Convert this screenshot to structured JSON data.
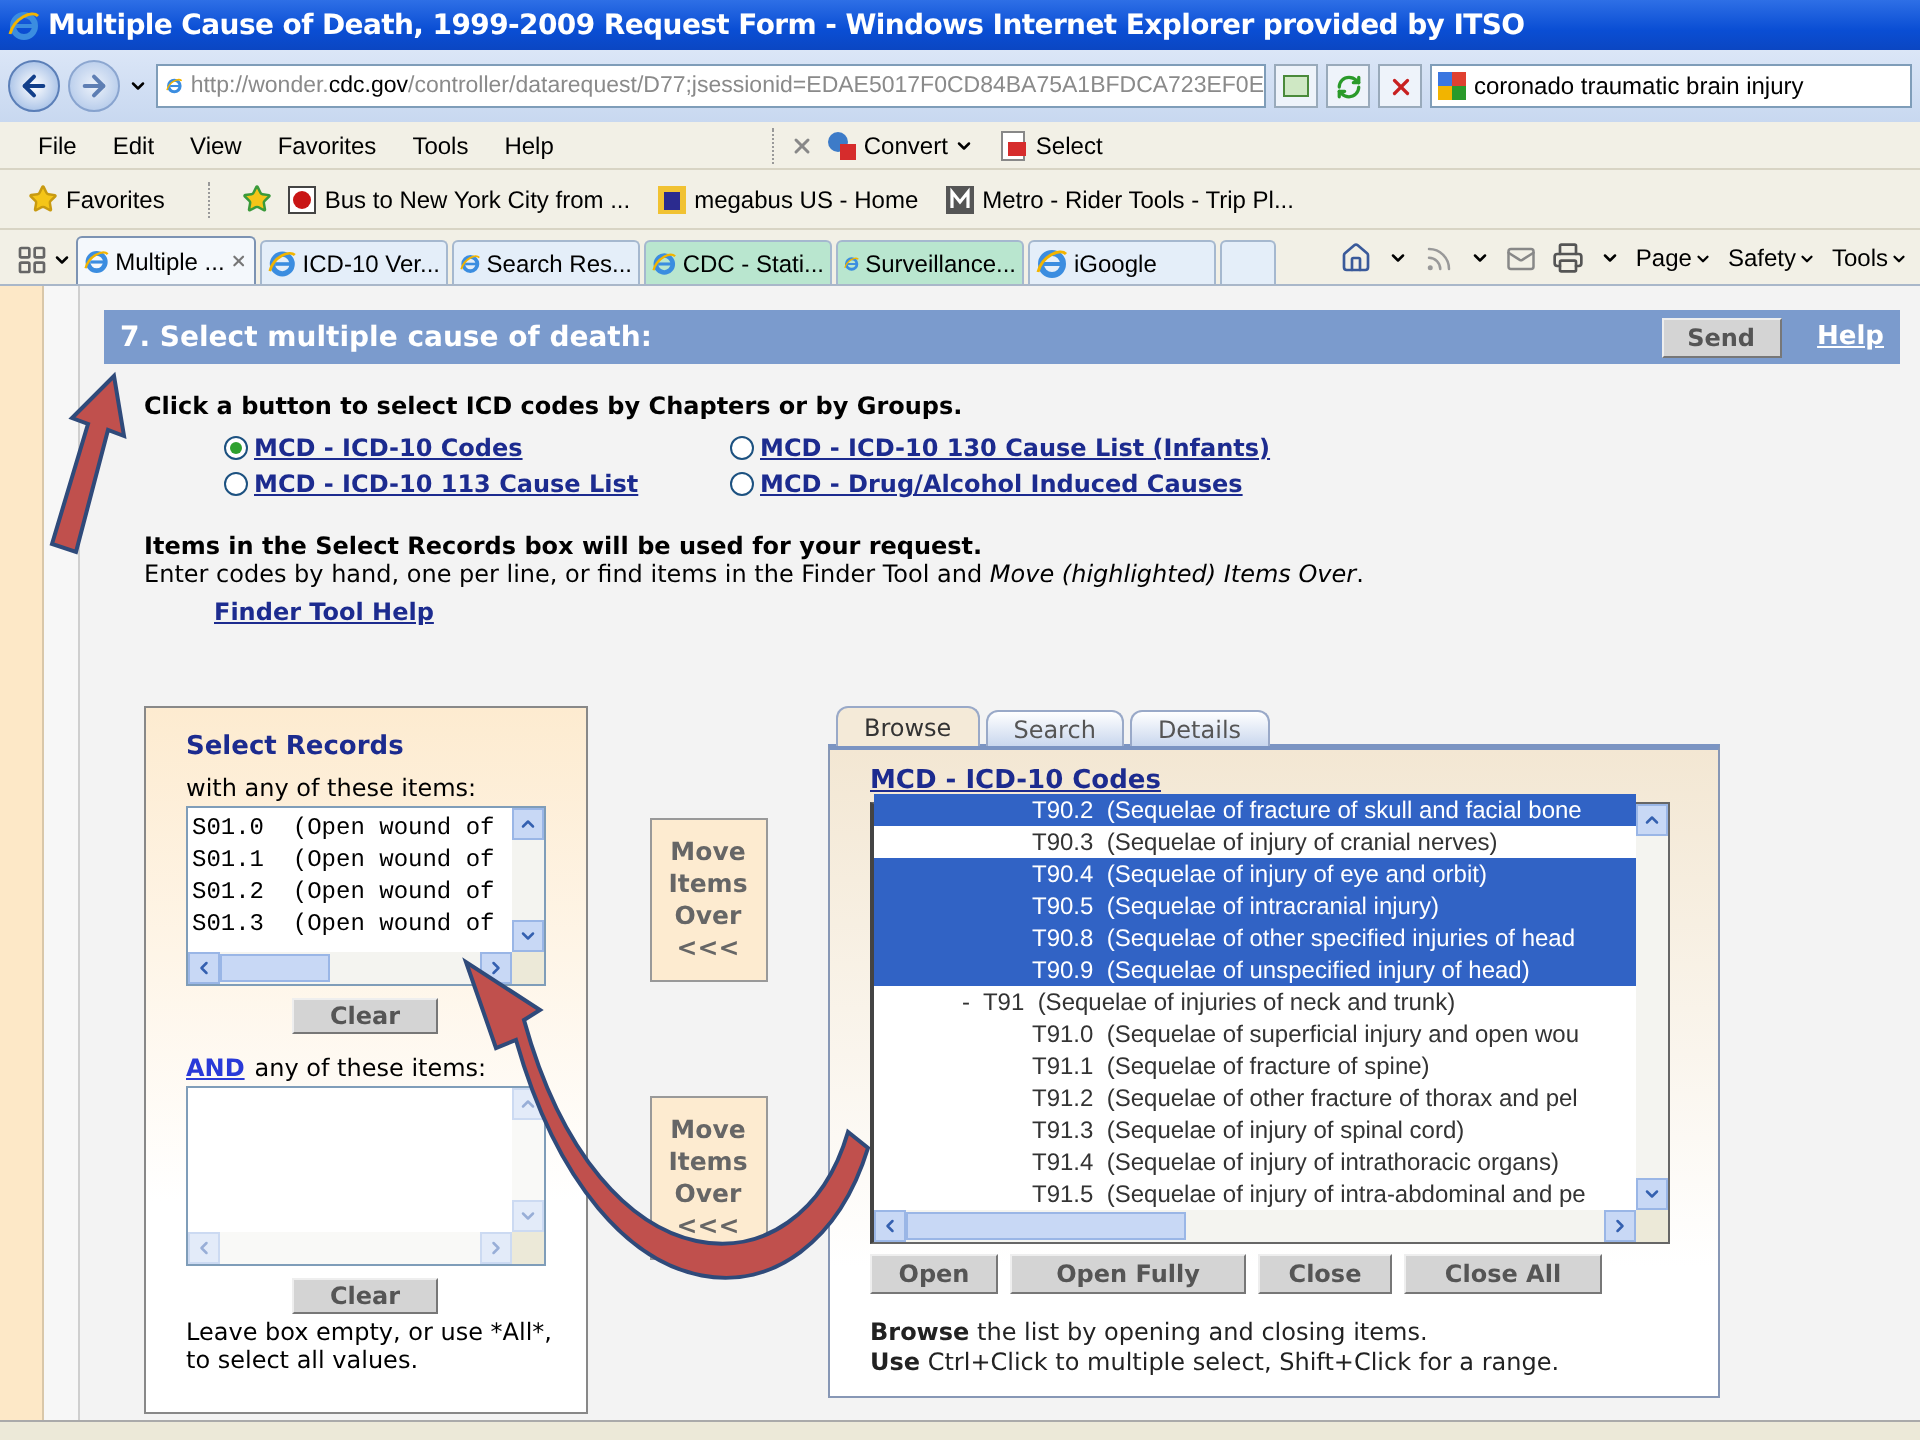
{
  "window": {
    "title": "Multiple Cause of Death, 1999-2009 Request Form - Windows Internet Explorer provided by ITSO"
  },
  "address_bar": {
    "url_start": "http://wonder.",
    "url_host": "cdc.gov",
    "url_end": "/controller/datarequest/D77;jsessionid=EDAE5017F0CD84BA75A1BFDCA723EF0E"
  },
  "search_field": {
    "value": "coronado traumatic brain injury"
  },
  "menu": [
    "File",
    "Edit",
    "View",
    "Favorites",
    "Tools",
    "Help"
  ],
  "toolbar_buttons": [
    {
      "label": "Convert",
      "kind": "convert"
    },
    {
      "label": "Select",
      "kind": "select"
    }
  ],
  "favorites_bar": {
    "label": "Favorites",
    "links": [
      {
        "label": "Bus to New York City from ...",
        "kind": "bus"
      },
      {
        "label": "megabus US - Home",
        "kind": "megabus"
      },
      {
        "label": "Metro - Rider Tools - Trip Pl...",
        "kind": "metro"
      }
    ]
  },
  "tabs": [
    {
      "label": "Multiple ...",
      "selected": true,
      "color": "#f4f8fc"
    },
    {
      "label": "ICD-10 Ver...",
      "selected": false,
      "color": "#e4eef9"
    },
    {
      "label": "Search Res...",
      "selected": false,
      "color": "#e4eef9"
    },
    {
      "label": "CDC - Stati...",
      "selected": false,
      "color": "#b9e6cf"
    },
    {
      "label": "Surveillance...",
      "selected": false,
      "color": "#b9e6cf"
    },
    {
      "label": "iGoogle",
      "selected": false,
      "color": "#e4eef9"
    }
  ],
  "command_bar": [
    "Page",
    "Safety",
    "Tools"
  ],
  "section": {
    "title": "7. Select multiple cause of death:",
    "send": "Send",
    "help": "Help",
    "instruction": "Click a button to select ICD codes by Chapters or by Groups.",
    "options": [
      {
        "label": "MCD - ICD-10 Codes",
        "selected": true
      },
      {
        "label": "MCD - ICD-10 130 Cause List (Infants)",
        "selected": false
      },
      {
        "label": "MCD - ICD-10 113 Cause List",
        "selected": false
      },
      {
        "label": "MCD - Drug/Alcohol Induced Causes",
        "selected": false
      }
    ],
    "items_heading": "Items in the Select Records box will be used for your request.",
    "items_text": "Enter codes by hand, one per line, or find items in the Finder Tool and *Move (highlighted) Items Over*.",
    "finder_help": "Finder Tool Help"
  },
  "select_records": {
    "title": "Select Records",
    "first_label": "with any of these items:",
    "first_items": [
      "S01.0  (Open wound of",
      "S01.1  (Open wound of",
      "S01.2  (Open wound of",
      "S01.3  (Open wound of"
    ],
    "clear": "Clear",
    "and_link": "AND",
    "second_label": "any of these items:",
    "second_clear": "Clear",
    "note": "Leave box empty, or use *All*, to select all values."
  },
  "move_buttons": [
    "Move Items Over <<<",
    "Move Items Over <<<"
  ],
  "finder": {
    "tabs": [
      {
        "label": "Browse",
        "selected": true
      },
      {
        "label": "Search",
        "selected": false
      },
      {
        "label": "Details",
        "selected": false
      }
    ],
    "heading": "MCD - ICD-10 Codes",
    "tree": [
      {
        "code": "T90.2",
        "label": "(Sequelae of fracture of skull and facial bone",
        "selected": true
      },
      {
        "code": "T90.3",
        "label": "(Sequelae of injury of cranial nerves)",
        "selected": false
      },
      {
        "code": "T90.4",
        "label": "(Sequelae of injury of eye and orbit)",
        "selected": true
      },
      {
        "code": "T90.5",
        "label": "(Sequelae of intracranial injury)",
        "selected": true
      },
      {
        "code": "T90.8",
        "label": "(Sequelae of other specified injuries of head",
        "selected": true
      },
      {
        "code": "T90.9",
        "label": "(Sequelae of unspecified injury of head)",
        "selected": true
      },
      {
        "code": "T91",
        "label": "(Sequelae of injuries of neck and trunk)",
        "selected": false,
        "expander": "-",
        "children": [
          {
            "code": "T91.0",
            "label": "(Sequelae of superficial injury and open wou",
            "selected": false
          },
          {
            "code": "T91.1",
            "label": "(Sequelae of fracture of spine)",
            "selected": false
          },
          {
            "code": "T91.2",
            "label": "(Sequelae of other fracture of thorax and pel",
            "selected": false
          },
          {
            "code": "T91.3",
            "label": "(Sequelae of injury of spinal cord)",
            "selected": false
          },
          {
            "code": "T91.4",
            "label": "(Sequelae of injury of intrathoracic organs)",
            "selected": false
          },
          {
            "code": "T91.5",
            "label": "(Sequelae of injury of intra-abdominal and pe",
            "selected": false
          }
        ]
      }
    ],
    "buttons": [
      "Open",
      "Open Fully",
      "Close",
      "Close All"
    ],
    "help": [
      "**Browse** the list by opening and closing items.",
      "**Use** Ctrl+Click to multiple select, Shift+Click for a range."
    ]
  }
}
